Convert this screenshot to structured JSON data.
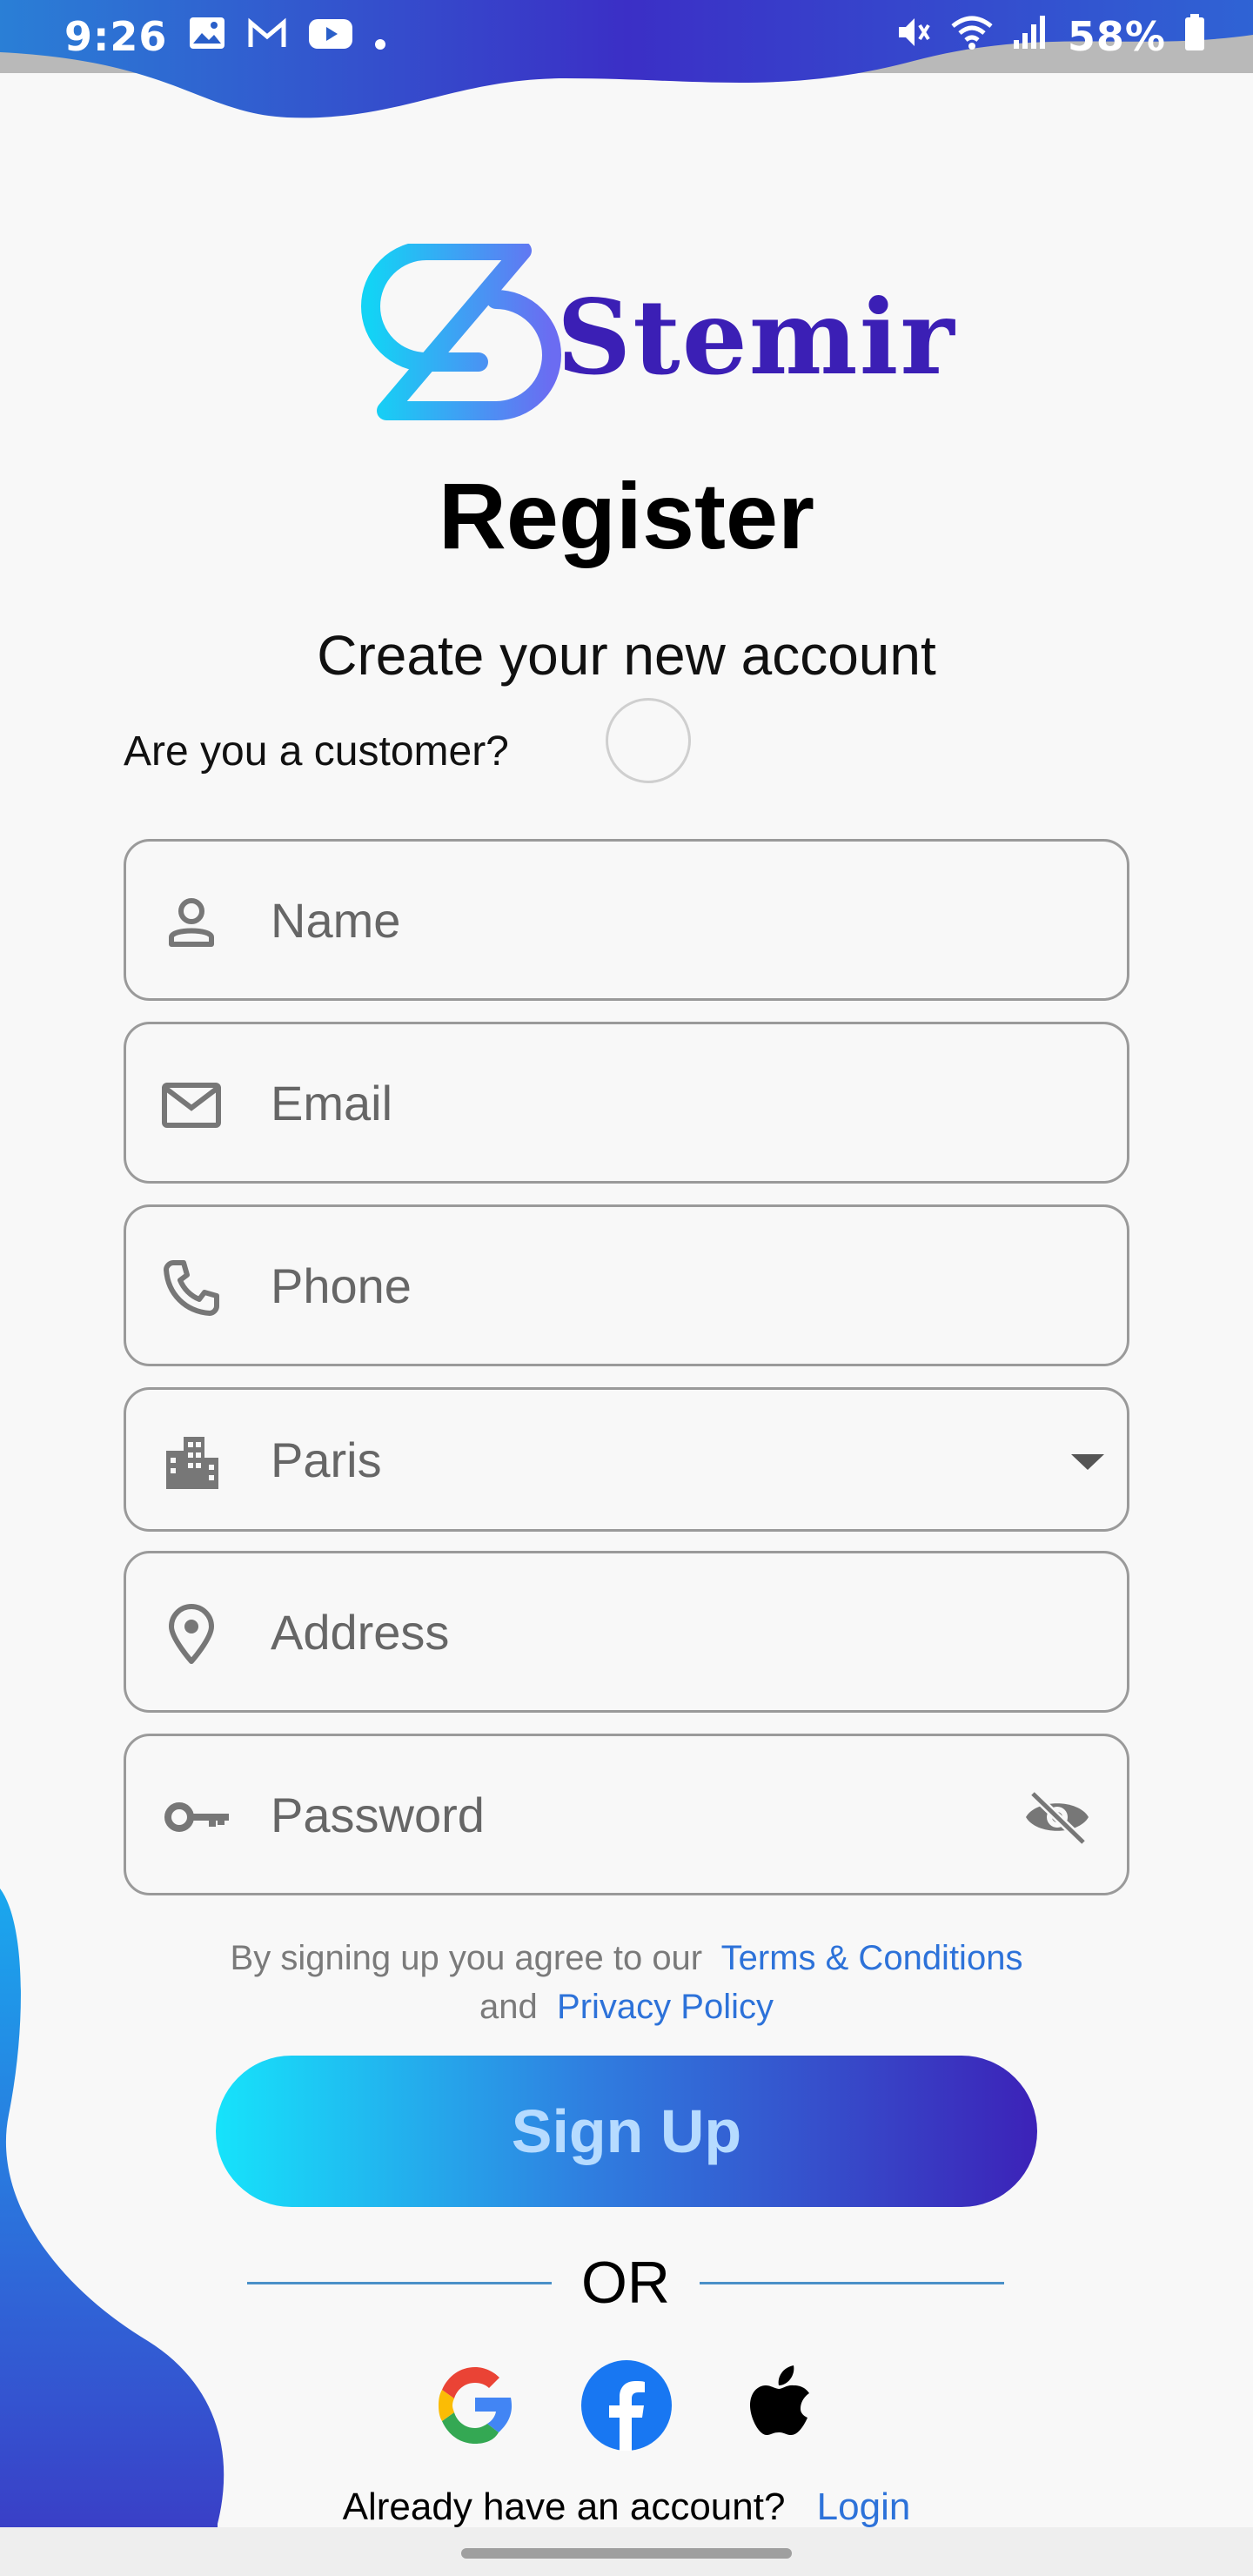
{
  "status_bar": {
    "time": "9:26",
    "battery": "58%",
    "left_icons": [
      "gallery-icon",
      "gmail-icon",
      "youtube-icon",
      "dot-icon"
    ],
    "right_icons": [
      "mute-icon",
      "wifi-icon",
      "signal-icon",
      "battery-icon"
    ]
  },
  "brand": {
    "name": "Stemir"
  },
  "page": {
    "title": "Register",
    "subtitle": "Create your new account"
  },
  "customer": {
    "label": "Are you a customer?",
    "checked": false
  },
  "form": {
    "name": {
      "placeholder": "Name",
      "icon": "person-icon"
    },
    "email": {
      "placeholder": "Email",
      "icon": "mail-icon"
    },
    "phone": {
      "placeholder": "Phone",
      "icon": "phone-icon"
    },
    "city": {
      "value": "Paris",
      "icon": "building-icon"
    },
    "address": {
      "placeholder": "Address",
      "icon": "location-pin-icon"
    },
    "password": {
      "placeholder": "Password",
      "icon": "key-icon",
      "toggle_icon": "eye-off-icon"
    }
  },
  "terms": {
    "prefix": "By signing up you agree to our",
    "terms_link": "Terms & Conditions",
    "and": "and",
    "privacy_link": "Privacy Policy"
  },
  "signup_button": "Sign Up",
  "divider_text": "OR",
  "social": [
    "google-icon",
    "facebook-icon",
    "apple-icon"
  ],
  "login": {
    "prompt": "Already have an account?",
    "link": "Login"
  },
  "colors": {
    "brand": "#3b1fb5",
    "link": "#2d72d9",
    "gradient_start": "#16e3fb",
    "gradient_end": "#3c22b8"
  }
}
